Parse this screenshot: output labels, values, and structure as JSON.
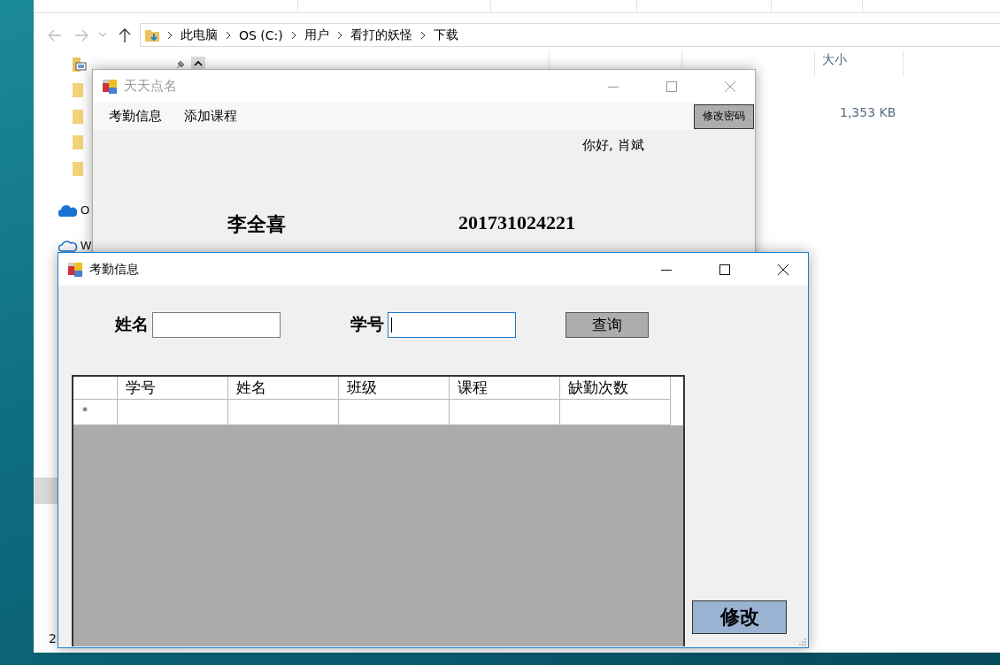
{
  "explorer": {
    "breadcrumb": [
      "此电脑",
      "OS (C:)",
      "用户",
      "看打的妖怪",
      "下载"
    ],
    "nav_items": [
      {
        "kind": "pictures",
        "pinned": true
      },
      {
        "kind": "folder"
      },
      {
        "kind": "folder"
      },
      {
        "kind": "folder"
      },
      {
        "kind": "folder"
      },
      {
        "kind": "onedrive",
        "label": "O"
      },
      {
        "kind": "cloud",
        "label": "W"
      }
    ],
    "columns": [
      "大小"
    ],
    "file_size": "1,353 KB",
    "status_text": "2"
  },
  "main_window": {
    "title": "天天点名",
    "menu": [
      "考勤信息",
      "添加课程"
    ],
    "change_password_button": "修改密码",
    "greeting": "你好, 肖斌",
    "student_name": "李全喜",
    "student_id": "201731024221"
  },
  "attendance_window": {
    "title": "考勤信息",
    "fields": [
      {
        "label": "姓名",
        "focused": false
      },
      {
        "label": "学号",
        "focused": true
      }
    ],
    "query_button": "查询",
    "grid": {
      "columns": [
        "学号",
        "姓名",
        "班级",
        "课程",
        "缺勤次数"
      ],
      "new_row_marker": "*"
    },
    "edit_button": "修改"
  }
}
